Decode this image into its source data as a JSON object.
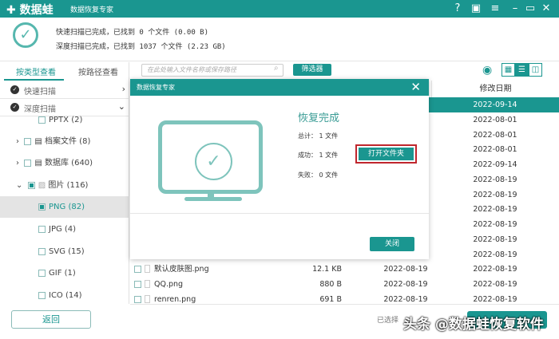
{
  "app": {
    "logo": "✚ 数据蛙",
    "subtitle": "数据恢复专家"
  },
  "window_icons": [
    "help-icon",
    "save-icon",
    "menu-icon",
    "minimize-icon",
    "maximize-icon",
    "close-icon"
  ],
  "status": {
    "quick": "快速扫描已完成，已找到 0 个文件 (0.00  B)",
    "deep": "深度扫描已完成，已找到 1037 个文件 (2.23 GB)"
  },
  "sidebar": {
    "tabs": [
      "按类型查看",
      "按路径查看"
    ],
    "quick_scan": "快速扫描",
    "deep_scan": "深度扫描",
    "tree": [
      {
        "label": "PPTX (2)"
      },
      {
        "label": "档案文件 (8)"
      },
      {
        "label": "数据库 (640)"
      },
      {
        "label": "图片 (116)"
      },
      {
        "label": "PNG (82)"
      },
      {
        "label": "JPG (4)"
      },
      {
        "label": "SVG (15)"
      },
      {
        "label": "GIF (1)"
      },
      {
        "label": "ICO (14)"
      }
    ],
    "back": "返回"
  },
  "toolbar": {
    "search_placeholder": "在此处输入文件名称或保存路径",
    "filter": "筛选器"
  },
  "table": {
    "date_header": "修改日期",
    "rows": [
      {
        "date": "2022-09-14"
      },
      {
        "date": "2022-08-01"
      },
      {
        "date": "2022-08-01"
      },
      {
        "date": "2022-08-01"
      },
      {
        "date": "2022-09-14"
      },
      {
        "date": "2022-08-19"
      },
      {
        "date": "2022-08-19"
      },
      {
        "date": "2022-08-19"
      },
      {
        "date": "2022-08-19"
      },
      {
        "date": "2022-08-19"
      },
      {
        "date": "2022-08-19"
      },
      {
        "name": "默认皮肤图.png",
        "size": "12.1 KB",
        "created": "2022-08-19",
        "date": "2022-08-19"
      },
      {
        "name": "QQ.png",
        "size": "880  B",
        "created": "2022-08-19",
        "date": "2022-08-19"
      },
      {
        "name": "renren.png",
        "size": "691  B",
        "created": "2022-08-19",
        "date": "2022-08-19"
      }
    ]
  },
  "bottom": {
    "selected": "已选择"
  },
  "watermark": "头条 @数据蛙恢复软件",
  "dialog": {
    "title": "数据恢复专家",
    "heading": "恢复完成",
    "total": "总计：  1 文件",
    "success": "成功：  1 文件",
    "failed": "失败：  0 文件",
    "open_folder": "打开文件夹",
    "close": "关闭"
  },
  "colors": {
    "accent": "#1a9690",
    "highlight": "#c0262d"
  }
}
